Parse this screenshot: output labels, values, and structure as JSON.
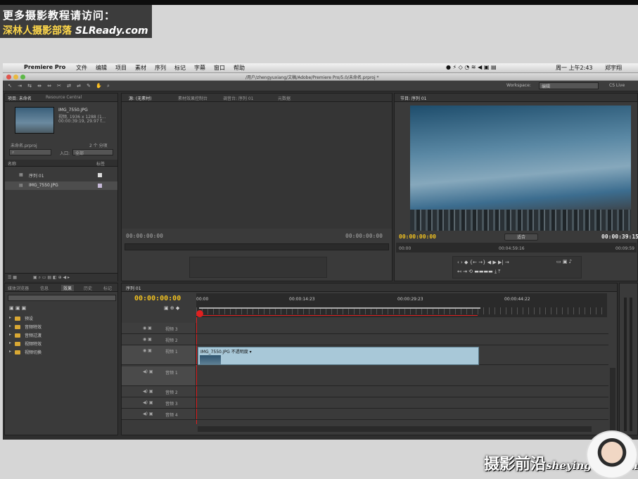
{
  "watermark_top": {
    "line1": "更多摄影教程请访问：",
    "line2_cn": "深林人摄影部落",
    "line2_en": "SLReady.com"
  },
  "watermark_bottom": {
    "cn": "摄影前沿",
    "en": "sheyingzyz.com"
  },
  "mac_menu": {
    "app_name": "Premiere Pro",
    "items": [
      "文件",
      "编辑",
      "项目",
      "素材",
      "序列",
      "标记",
      "字幕",
      "窗口",
      "帮助"
    ],
    "clock": "周一 上午2:43",
    "user": "郑宇翔"
  },
  "window_title": "/用户/zhengyuxiang/文稿/Adobe/Premiere Pro/5.0/未命名.prproj *",
  "toolbar": {
    "workspace_label": "Workspace:",
    "workspace_value": "编辑",
    "cs_live": "CS Live"
  },
  "project_panel": {
    "tabs": [
      "项目: 未命名",
      "Resource Central"
    ],
    "clip_name": "IMG_7550.JPG",
    "clip_info": [
      "视频, 1936 x 1288 (1...",
      "00:00:39:19, 29.97 f..."
    ],
    "project_file": "未命名.prproj",
    "item_count": "2 个 分项",
    "in_label": "入口:",
    "in_value": "全部",
    "col_name": "名称",
    "col_label": "标签",
    "items": [
      "序列 01",
      "IMG_7550.JPG"
    ]
  },
  "source_panel": {
    "tabs": [
      "源: (无素材)",
      "素材效果控制台",
      "调音台: 序列 01",
      "元数据"
    ],
    "tc_left": "00:00:00:00",
    "tc_right": "00:00:00:00"
  },
  "program_panel": {
    "tab": "节目: 序列 01",
    "tc_current": "00:00:00:00",
    "fit": "适合",
    "tc_duration": "00:00:39:15",
    "ruler": [
      "00:00",
      "00:04:59:16",
      "00:09:59"
    ]
  },
  "effects_panel": {
    "tabs": [
      "媒体浏览器",
      "信息",
      "效果",
      "历史",
      "标记"
    ],
    "folders": [
      "预设",
      "音频特效",
      "音频过渡",
      "视频特效",
      "视频切换"
    ]
  },
  "timeline": {
    "tab": "序列 01",
    "tc": "00:00:00:00",
    "ruler": [
      "00:00",
      "00:00:14:23",
      "00:00:29:23",
      "00:00:44:22"
    ],
    "video_tracks": [
      "视频 3",
      "视频 2",
      "视频 1"
    ],
    "audio_tracks": [
      "音频 1",
      "音频 2",
      "音频 3",
      "音频 4"
    ],
    "clip_label": "IMG_7550.JPG  不透明度 ▾"
  },
  "colors": {
    "timecode": "#f0c020",
    "clip": "#a8c8d8",
    "playhead": "#e02020",
    "folder": "#d9a834"
  }
}
